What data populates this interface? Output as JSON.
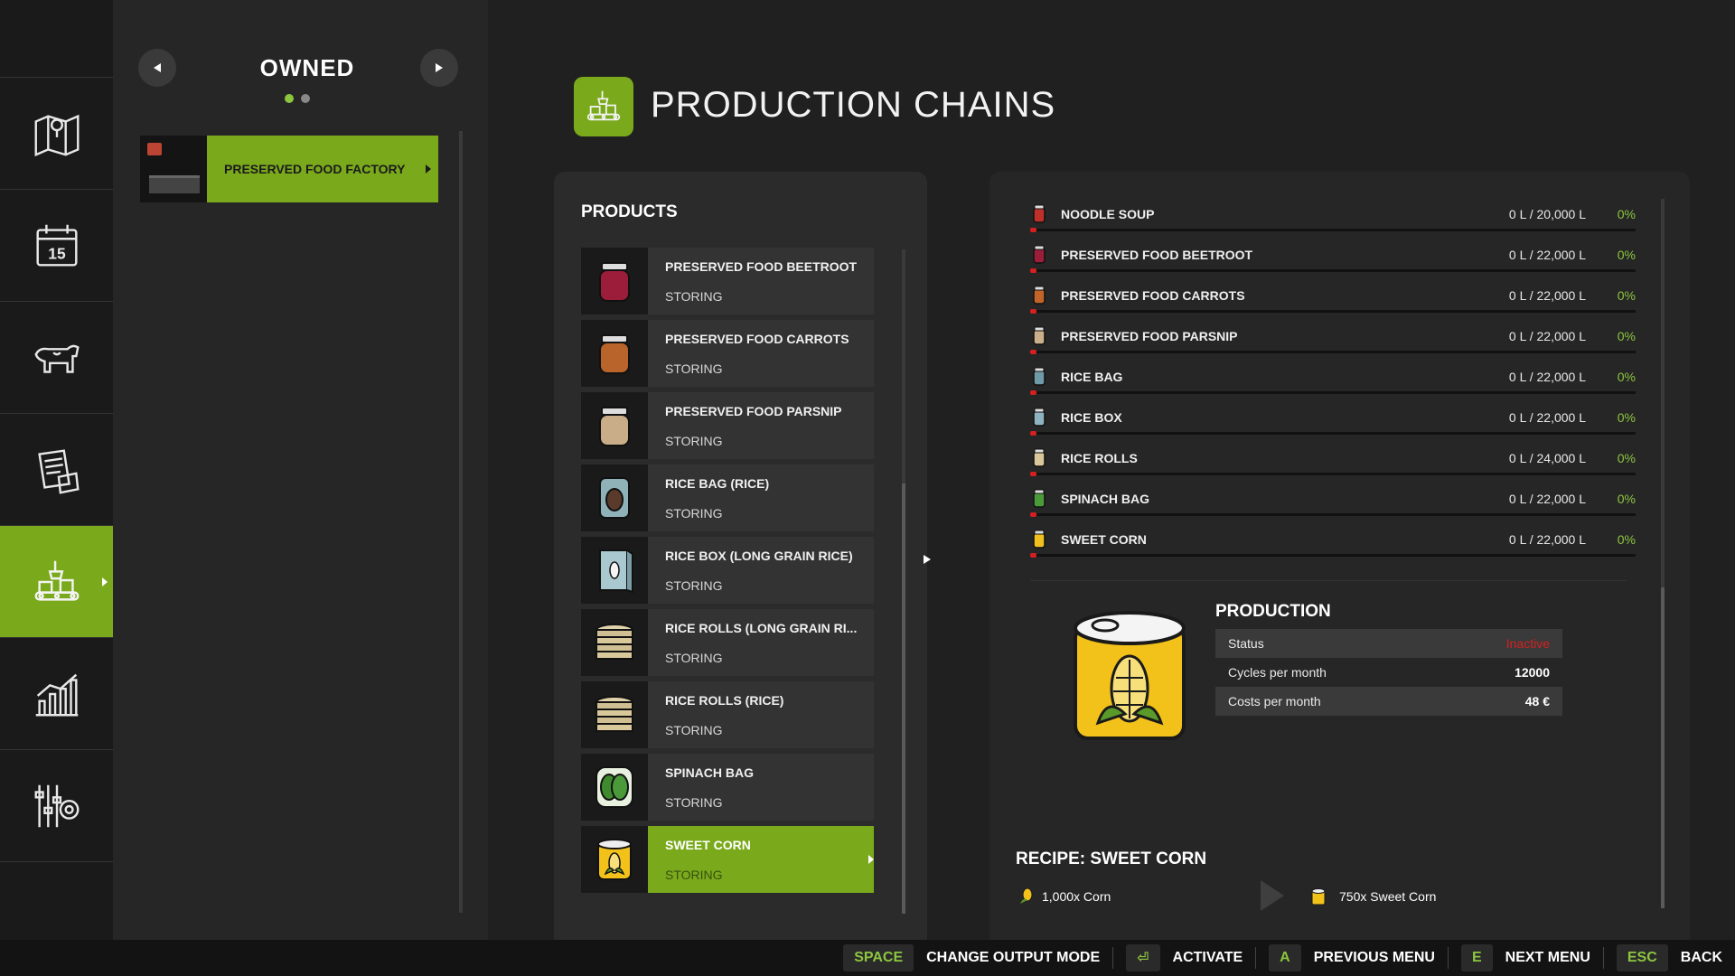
{
  "owned": {
    "title": "OWNED",
    "page_count": 2,
    "active_page": 1,
    "factory": {
      "label": "PRESERVED FOOD FACTORY"
    }
  },
  "sidebar": {
    "items": [
      {
        "icon": "map-icon"
      },
      {
        "icon": "calendar-icon",
        "badge": "15"
      },
      {
        "icon": "animals-icon"
      },
      {
        "icon": "contracts-icon"
      },
      {
        "icon": "production-icon",
        "active": true
      },
      {
        "icon": "statistics-icon"
      },
      {
        "icon": "settings-icon"
      }
    ]
  },
  "header": {
    "title": "PRODUCTION CHAINS",
    "icon": "production-icon"
  },
  "products": {
    "title": "PRODUCTS",
    "items": [
      {
        "name": "PRESERVED FOOD BEETROOT",
        "status": "STORING",
        "icon": "beetroot-jar-icon"
      },
      {
        "name": "PRESERVED FOOD CARROTS",
        "status": "STORING",
        "icon": "carrot-jar-icon"
      },
      {
        "name": "PRESERVED FOOD PARSNIP",
        "status": "STORING",
        "icon": "parsnip-jar-icon"
      },
      {
        "name": "RICE BAG (RICE)",
        "status": "STORING",
        "icon": "rice-bag-icon"
      },
      {
        "name": "RICE BOX (LONG GRAIN RICE)",
        "status": "STORING",
        "icon": "rice-box-icon"
      },
      {
        "name": "RICE ROLLS (LONG GRAIN RI...",
        "status": "STORING",
        "icon": "rice-rolls-icon"
      },
      {
        "name": "RICE ROLLS (RICE)",
        "status": "STORING",
        "icon": "rice-rolls-icon"
      },
      {
        "name": "SPINACH BAG",
        "status": "STORING",
        "icon": "spinach-bag-icon"
      },
      {
        "name": "SWEET CORN",
        "status": "STORING",
        "icon": "sweet-corn-can-icon",
        "selected": true
      }
    ]
  },
  "storage": [
    {
      "name": "NOODLE SOUP",
      "amount": "0 L / 20,000 L",
      "percent": "0%",
      "fill": 0,
      "color": "#c0302a"
    },
    {
      "name": "PRESERVED FOOD BEETROOT",
      "amount": "0 L / 22,000 L",
      "percent": "0%",
      "fill": 0,
      "color": "#9c1d3a"
    },
    {
      "name": "PRESERVED FOOD CARROTS",
      "amount": "0 L / 22,000 L",
      "percent": "0%",
      "fill": 0,
      "color": "#c0642a"
    },
    {
      "name": "PRESERVED FOOD PARSNIP",
      "amount": "0 L / 22,000 L",
      "percent": "0%",
      "fill": 0,
      "color": "#c9b08a"
    },
    {
      "name": "RICE BAG",
      "amount": "0 L / 22,000 L",
      "percent": "0%",
      "fill": 0,
      "color": "#6f9aa8"
    },
    {
      "name": "RICE BOX",
      "amount": "0 L / 22,000 L",
      "percent": "0%",
      "fill": 0,
      "color": "#8fb2c0"
    },
    {
      "name": "RICE ROLLS",
      "amount": "0 L / 24,000 L",
      "percent": "0%",
      "fill": 0,
      "color": "#d8c79a"
    },
    {
      "name": "SPINACH BAG",
      "amount": "0 L / 22,000 L",
      "percent": "0%",
      "fill": 0,
      "color": "#4a9a3a"
    },
    {
      "name": "SWEET CORN",
      "amount": "0 L / 22,000 L",
      "percent": "0%",
      "fill": 0,
      "color": "#f0c020"
    }
  ],
  "production": {
    "title": "PRODUCTION",
    "rows": [
      {
        "key": "Status",
        "value": "Inactive"
      },
      {
        "key": "Cycles per month",
        "value": "12000"
      },
      {
        "key": "Costs per month",
        "value": "48 €"
      }
    ]
  },
  "recipe": {
    "title": "RECIPE: SWEET CORN",
    "input": "1,000x Corn",
    "output": "750x Sweet Corn"
  },
  "footer": [
    {
      "key": "SPACE",
      "label": "CHANGE OUTPUT MODE"
    },
    {
      "key": "⏎",
      "label": "ACTIVATE"
    },
    {
      "key": "A",
      "label": "PREVIOUS MENU"
    },
    {
      "key": "E",
      "label": "NEXT MENU"
    },
    {
      "key": "ESC",
      "label": "BACK"
    }
  ],
  "colors": {
    "accent": "#7aaa1c",
    "alert": "#d52020",
    "percent": "#8cc63f"
  }
}
